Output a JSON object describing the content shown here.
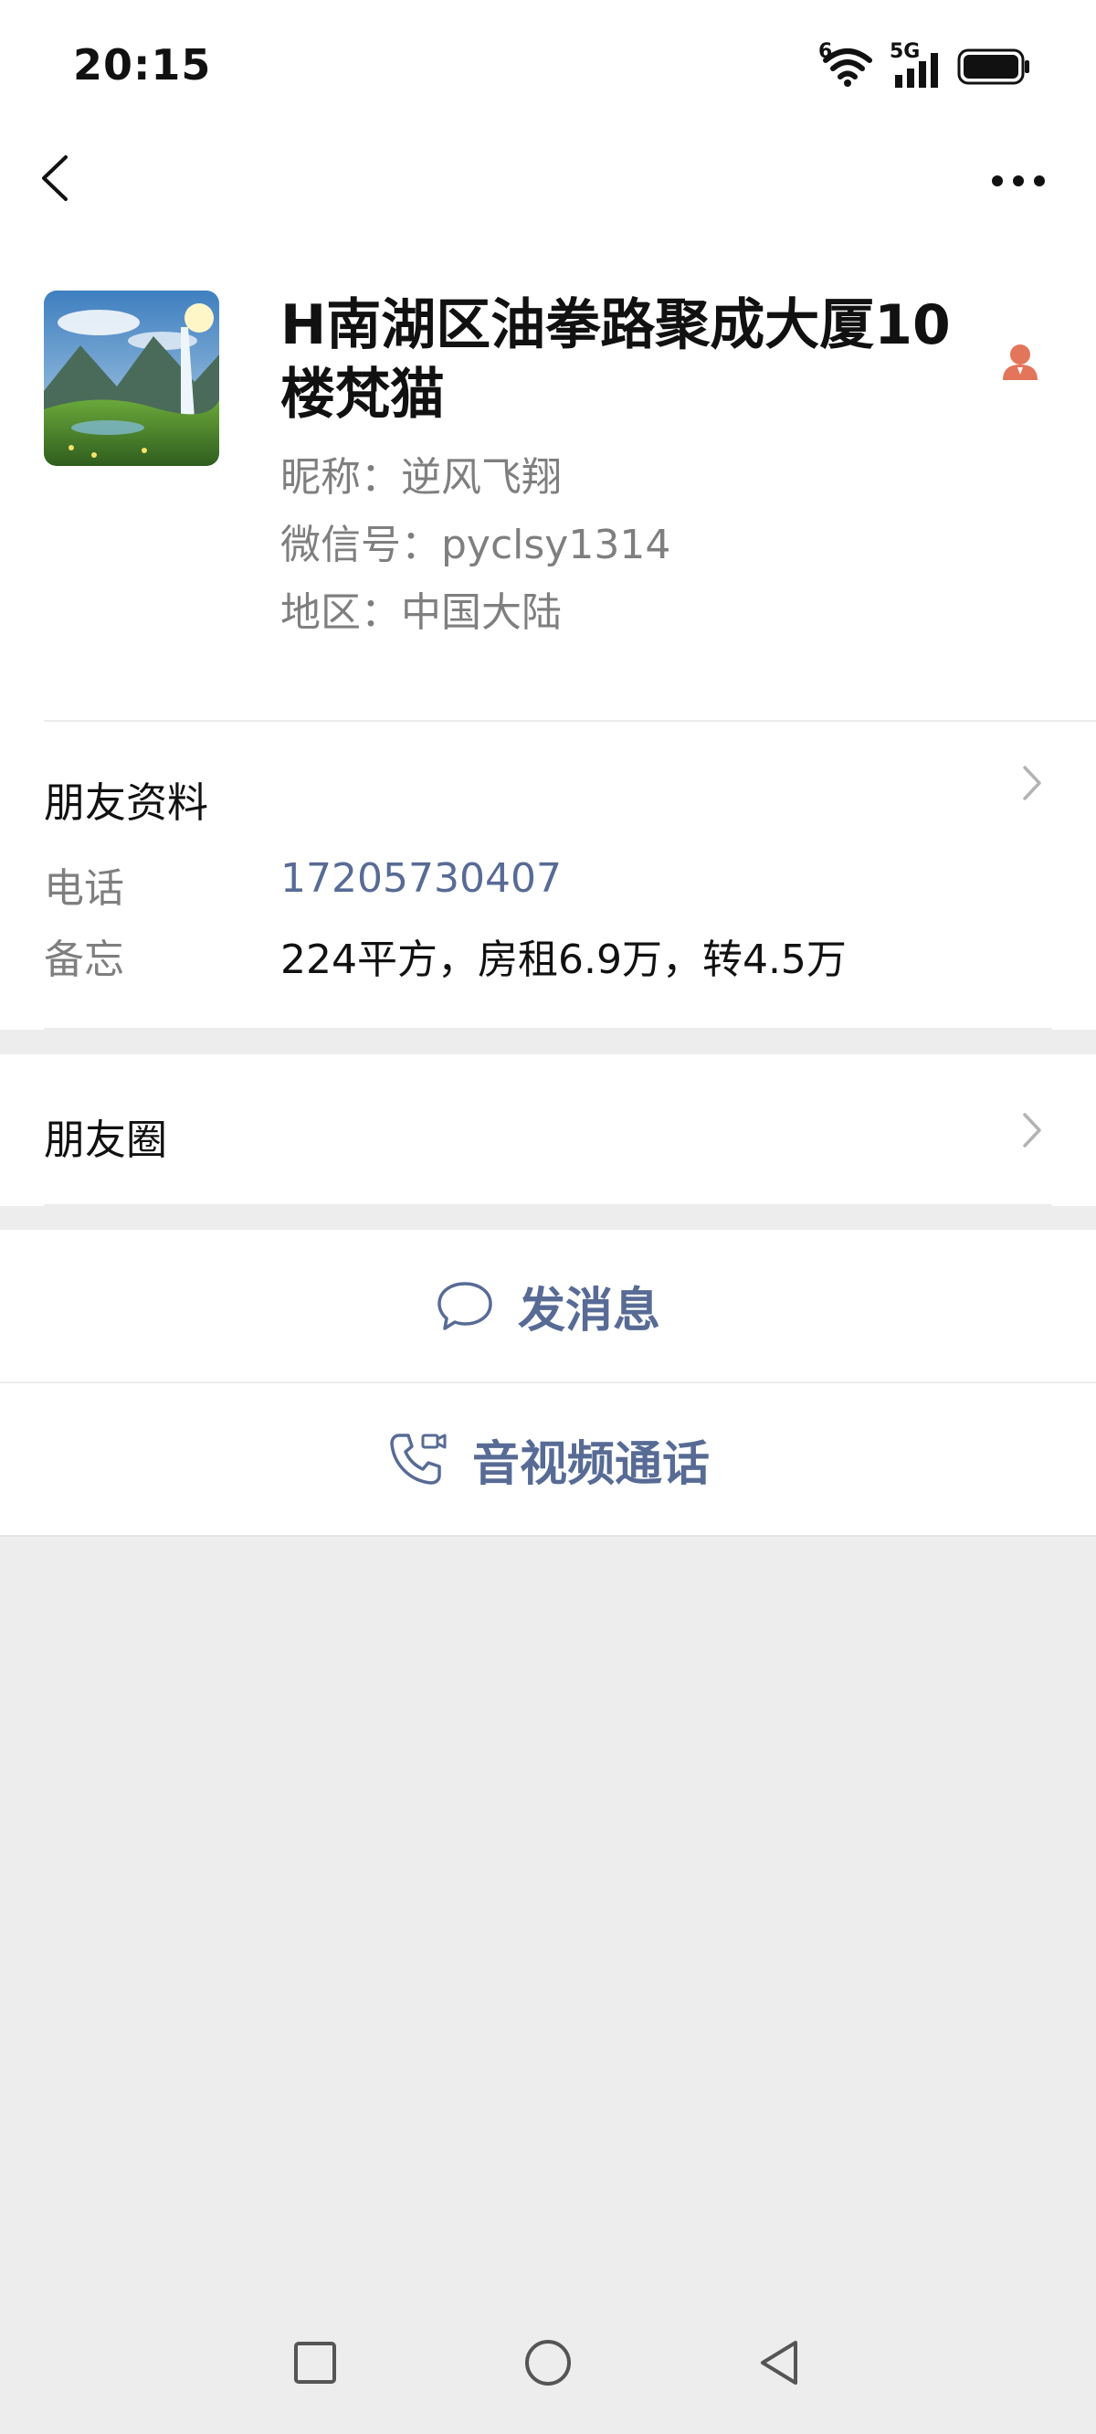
{
  "status_bar": {
    "time": "20:15",
    "wifi_badge": "6",
    "network": "5G",
    "icons": [
      "wifi-icon",
      "signal-icon",
      "battery-icon"
    ]
  },
  "nav": {
    "back_icon": "chevron-left-icon",
    "more_icon": "more-dots-icon"
  },
  "profile": {
    "name": "H南湖区油拳路聚成大厦10楼梵猫",
    "nickname": "昵称：逆风飞翔",
    "wechat_id": "微信号：pyclsy1314",
    "region": "地区：中国大陆",
    "badge_icon": "agent-user-icon"
  },
  "friend_info": {
    "title": "朋友资料",
    "phone_label": "电话",
    "phone_value": "17205730407",
    "note_label": "备忘",
    "note_value": "224平方，房租6.9万，转4.5万"
  },
  "moments": {
    "title": "朋友圈"
  },
  "actions": {
    "message_label": "发消息",
    "call_label": "音视频通话"
  },
  "colors": {
    "link_blue": "#576b95",
    "badge_orange": "#e2755a",
    "background_gray": "#ededed"
  }
}
